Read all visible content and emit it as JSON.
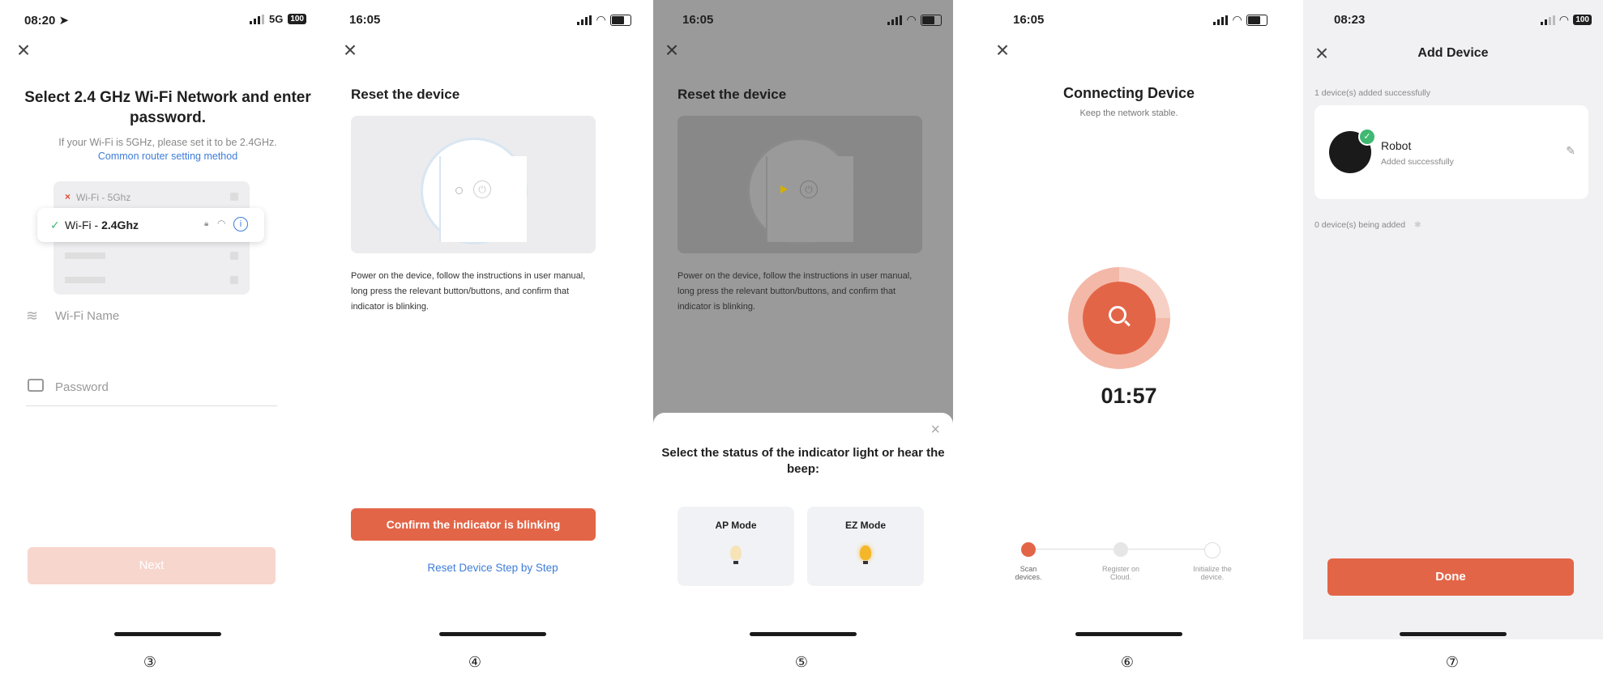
{
  "screens": [
    {
      "status": {
        "time": "08:20 ➤",
        "network": "5G",
        "battery": "100"
      },
      "title": "Select 2.4 GHz Wi-Fi Network and enter password.",
      "hint": "If your Wi-Fi is 5GHz, please set it to be 2.4GHz.",
      "link": "Common router setting method",
      "wifi_5g": "Wi-Fi - 5Ghz",
      "wifi_24_prefix": "Wi-Fi - ",
      "wifi_24_band": "2.4Ghz",
      "wifi_name_placeholder": "Wi-Fi Name",
      "password_placeholder": "Password",
      "next": "Next",
      "step": "③"
    },
    {
      "status": {
        "time": "16:05"
      },
      "title": "Reset the device",
      "description": "Power on the device, follow the instructions in user manual, long press the relevant button/buttons, and confirm that indicator is blinking.",
      "confirm": "Confirm the indicator is blinking",
      "reset_link": "Reset Device Step by Step",
      "step": "④"
    },
    {
      "status": {
        "time": "16:05"
      },
      "title": "Reset the device",
      "description": "Power on the device, follow the instructions in user manual, long press the relevant button/buttons, and confirm that indicator is blinking.",
      "sheet_question": "Select the status of the indicator light or hear the beep:",
      "modes": [
        "AP Mode",
        "EZ Mode"
      ],
      "step": "⑤"
    },
    {
      "status": {
        "time": "16:05"
      },
      "title": "Connecting Device",
      "subtitle": "Keep the network stable.",
      "timer": "01:57",
      "steps": [
        "Scan devices.",
        "Register on Cloud.",
        "Initialize the device."
      ],
      "step": "⑥"
    },
    {
      "status": {
        "time": "08:23",
        "battery": "100"
      },
      "title": "Add Device",
      "success_label": "1 device(s) added successfully",
      "device_name": "Robot",
      "device_status": "Added successfully",
      "adding_label": "0 device(s) being added",
      "done": "Done",
      "step": "⑦"
    }
  ],
  "colors": {
    "accent": "#e36547",
    "accent_light": "#f7d6cd",
    "link": "#3d7dd8",
    "success": "#3fb872"
  }
}
